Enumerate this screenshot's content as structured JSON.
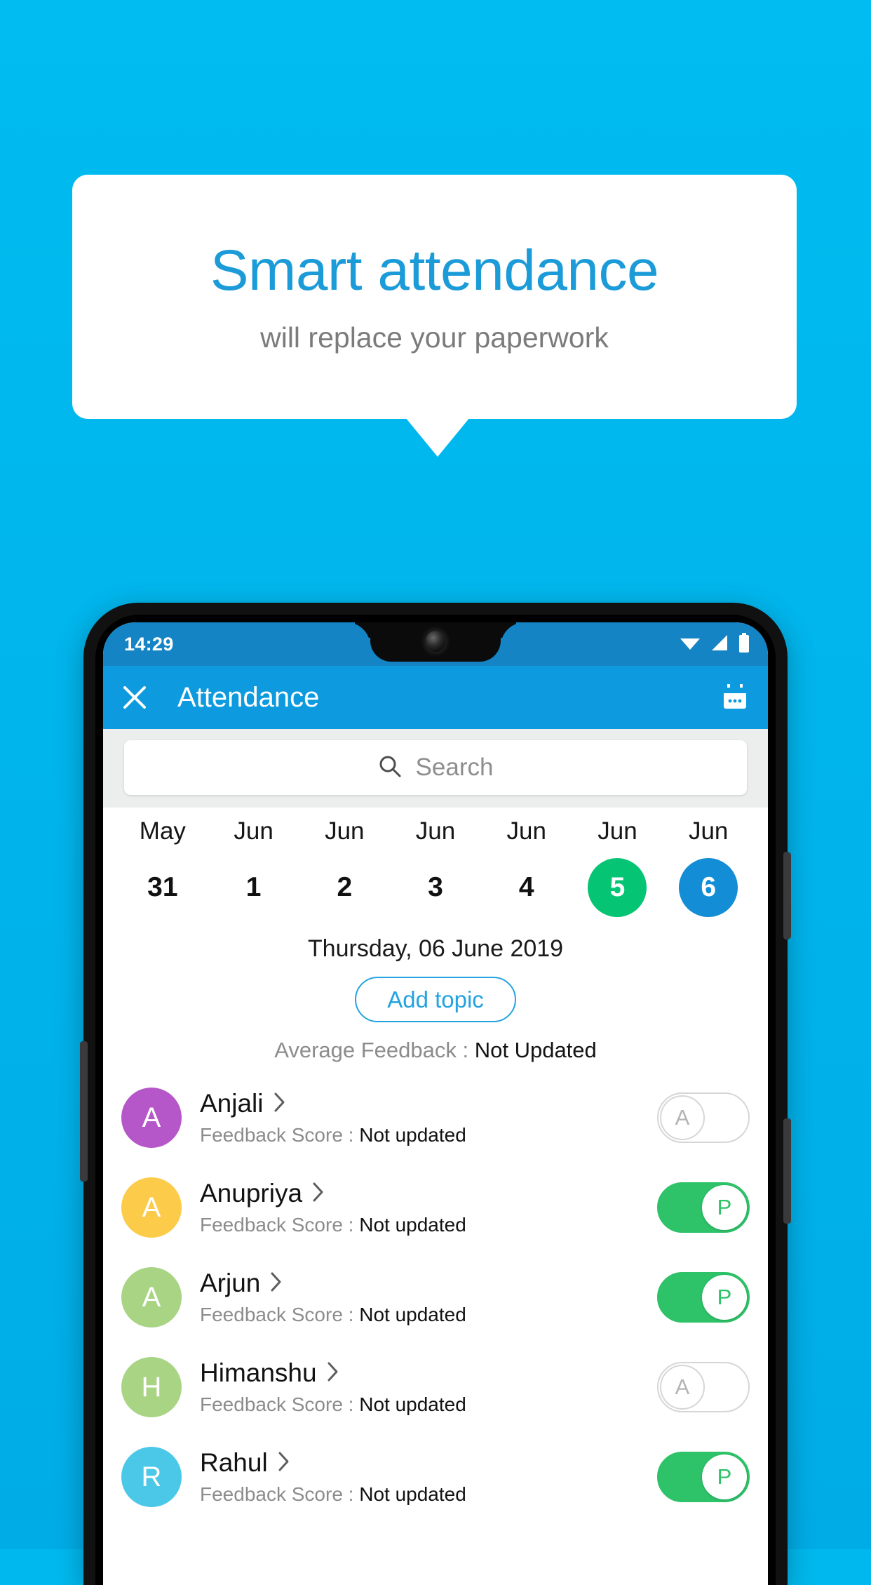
{
  "promo": {
    "title": "Smart attendance",
    "subtitle": "will replace your paperwork",
    "background_color": "#00b8ed",
    "title_color": "#1b9bd8"
  },
  "phone": {
    "statusbar": {
      "time": "14:29",
      "icons": [
        "wifi-icon",
        "signal-icon",
        "battery-icon"
      ],
      "background_color": "#1484c4"
    },
    "appbar": {
      "close_label": "×",
      "title": "Attendance",
      "calendar_icon": "calendar-icon",
      "background_color": "#0d9ade"
    },
    "search": {
      "placeholder": "Search",
      "icon": "search-icon"
    },
    "date_strip": [
      {
        "month": "May",
        "day": "31",
        "state": "normal"
      },
      {
        "month": "Jun",
        "day": "1",
        "state": "normal"
      },
      {
        "month": "Jun",
        "day": "2",
        "state": "normal"
      },
      {
        "month": "Jun",
        "day": "3",
        "state": "normal"
      },
      {
        "month": "Jun",
        "day": "4",
        "state": "normal"
      },
      {
        "month": "Jun",
        "day": "5",
        "state": "green"
      },
      {
        "month": "Jun",
        "day": "6",
        "state": "blue"
      }
    ],
    "day_title": "Thursday, 06 June 2019",
    "add_topic_label": "Add topic",
    "average_feedback": {
      "label": "Average Feedback : ",
      "value": "Not Updated"
    },
    "students": [
      {
        "initial": "A",
        "name": "Anjali",
        "avatar_color": "#b556c9",
        "score_label": "Feedback Score : ",
        "score_value": "Not updated",
        "attendance": "A",
        "present": false
      },
      {
        "initial": "A",
        "name": "Anupriya",
        "avatar_color": "#fbcb49",
        "score_label": "Feedback Score : ",
        "score_value": "Not updated",
        "attendance": "P",
        "present": true
      },
      {
        "initial": "A",
        "name": "Arjun",
        "avatar_color": "#a8d484",
        "score_label": "Feedback Score : ",
        "score_value": "Not updated",
        "attendance": "P",
        "present": true
      },
      {
        "initial": "H",
        "name": "Himanshu",
        "avatar_color": "#a8d484",
        "score_label": "Feedback Score : ",
        "score_value": "Not updated",
        "attendance": "A",
        "present": false
      },
      {
        "initial": "R",
        "name": "Rahul",
        "avatar_color": "#4bc8e8",
        "score_label": "Feedback Score : ",
        "score_value": "Not updated",
        "attendance": "P",
        "present": true
      }
    ]
  }
}
